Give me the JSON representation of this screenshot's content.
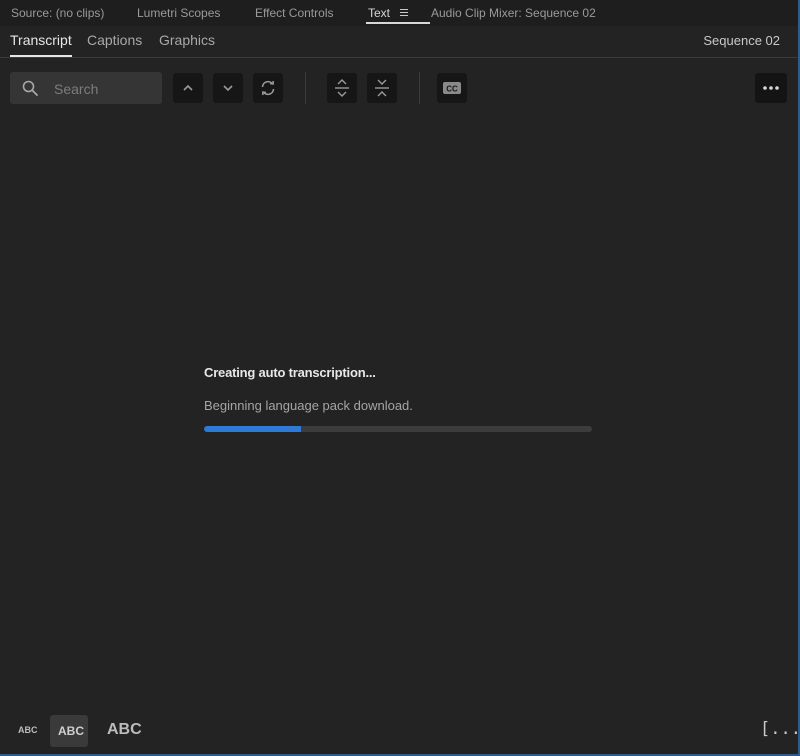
{
  "panel_tabs": [
    {
      "label": "Source: (no clips)"
    },
    {
      "label": "Lumetri Scopes"
    },
    {
      "label": "Effect Controls"
    },
    {
      "label": "Text"
    },
    {
      "label": "Audio Clip Mixer: Sequence 02"
    }
  ],
  "sub_tabs": [
    {
      "label": "Transcript"
    },
    {
      "label": "Captions"
    },
    {
      "label": "Graphics"
    }
  ],
  "active_sub_tab": "Transcript",
  "sequence_label": "Sequence 02",
  "search": {
    "placeholder": "Search",
    "value": ""
  },
  "toolbar_icons": [
    "search-icon",
    "chevron-up-icon",
    "chevron-down-icon",
    "refresh-icon",
    "expand-icon",
    "collapse-icon",
    "closed-captions-icon",
    "more-icon"
  ],
  "status": {
    "title": "Creating auto transcription...",
    "subtitle": "Beginning language pack download.",
    "progress": 0.25
  },
  "bottom_bar": {
    "abc_small": "ABC",
    "abc_medium": "ABC",
    "abc_large": "ABC",
    "fit_button": "[...]"
  },
  "colors": {
    "accent": "#2d7bd6",
    "background": "#232323",
    "frame_border": "#2f5a8a"
  }
}
